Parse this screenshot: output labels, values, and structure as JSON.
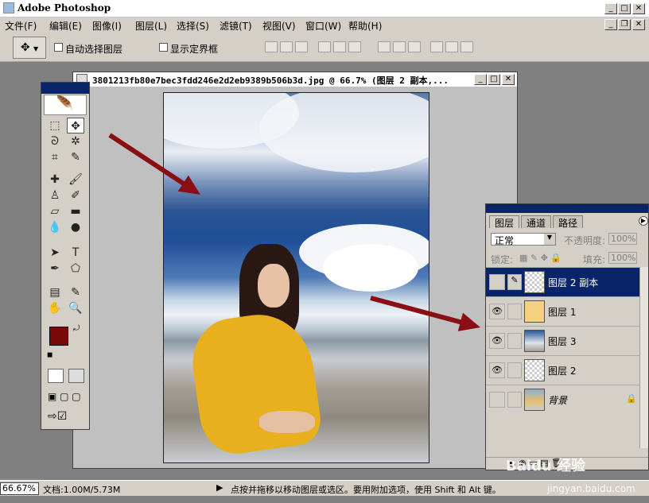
{
  "app": {
    "title": "Adobe Photoshop",
    "menu": [
      "文件(F)",
      "编辑(E)",
      "图像(I)",
      "图层(L)",
      "选择(S)",
      "滤镜(T)",
      "视图(V)",
      "窗口(W)",
      "帮助(H)"
    ]
  },
  "options": {
    "auto_select": "自动选择图层",
    "show_bounds": "显示定界框"
  },
  "document": {
    "title": "3801213fb80e7bec3fdd246e2d2eb9389b506b3d.jpg @ 66.7% (图层 2 副本,..."
  },
  "layers_panel": {
    "tabs": [
      "图层",
      "通道",
      "路径"
    ],
    "blend_mode": "正常",
    "opacity_label": "不透明度:",
    "opacity_value": "100%",
    "lock_label": "锁定:",
    "fill_label": "填充:",
    "fill_value": "100%",
    "layers": [
      {
        "name": "图层 2 副本",
        "visible": false,
        "selected": true
      },
      {
        "name": "图层 1",
        "visible": true,
        "selected": false
      },
      {
        "name": "图层 3",
        "visible": true,
        "selected": false
      },
      {
        "name": "图层 2",
        "visible": true,
        "selected": false
      },
      {
        "name": "背景",
        "visible": false,
        "selected": false
      }
    ]
  },
  "status": {
    "zoom": "66.67%",
    "doc_size": "文档:1.00M/5.73M",
    "hint": "点按并拖移以移动图层或选区。要用附加选项，使用 Shift 和 Alt 键。"
  },
  "watermark": {
    "text": "Baidu 经验",
    "url": "jingyan.baidu.com"
  },
  "colors": {
    "foreground": "#7a0a0a",
    "background": "#ffffff",
    "arrow": "#8a0f14",
    "selected_layer": "#0a246a"
  }
}
